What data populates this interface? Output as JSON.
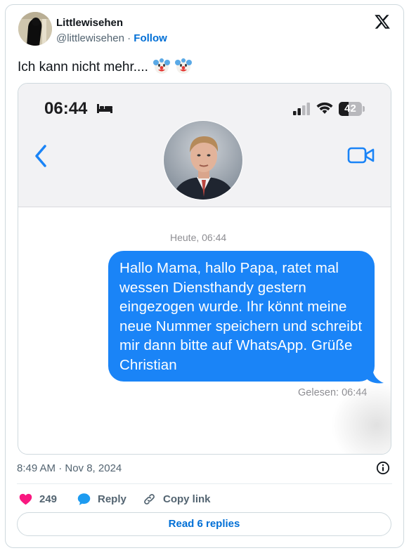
{
  "tweet": {
    "author_name": "Littlewisehen",
    "handle": "@littlewisehen",
    "separator": " · ",
    "follow_label": "Follow",
    "text": "Ich kann nicht mehr....",
    "emojis": [
      "clown-face",
      "clown-face"
    ],
    "timestamp": "8:49 AM · Nov 8, 2024",
    "likes": "249",
    "reply_label": "Reply",
    "copy_link_label": "Copy link",
    "read_replies_label": "Read 6 replies"
  },
  "screenshot": {
    "clock": "06:44",
    "battery": "42",
    "battery_level": 0.42,
    "date_label": "Heute, 06:44",
    "message": "Hallo Mama, hallo Papa, ratet mal wessen Diensthandy gestern eingezogen wurde. Ihr könnt meine neue Nummer speichern und schreibt mir dann bitte auf WhatsApp. Grüße Christian",
    "read_receipt": "Gelesen: 06:44"
  },
  "colors": {
    "accent": "#006fd6",
    "imessage_blue": "#1a84f7",
    "like_pink": "#f91880",
    "reply_blue": "#1d9bf0",
    "secondary_text": "#536471"
  },
  "icons": {
    "x_logo": "x-logo-icon",
    "sleep": "bed-icon",
    "signal": "signal-icon",
    "wifi": "wifi-icon",
    "back": "chevron-left-icon",
    "video": "video-camera-icon",
    "info": "info-icon",
    "like": "heart-icon",
    "reply": "speech-bubble-icon",
    "copy": "link-icon"
  }
}
